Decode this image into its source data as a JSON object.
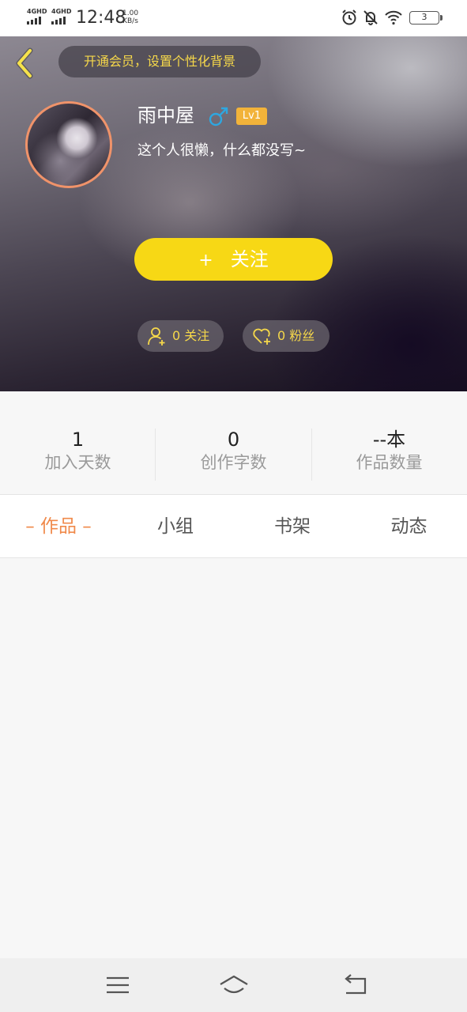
{
  "status_bar": {
    "network1": "4GHD",
    "network2": "4GHD",
    "time": "12:48",
    "speed_value": "1.00",
    "speed_unit": "KB/s",
    "battery": "3",
    "icons": [
      "alarm-icon",
      "mute-icon",
      "wifi-icon",
      "battery-icon"
    ]
  },
  "header": {
    "vip_banner": "开通会员，设置个性化背景",
    "username": "雨中屋",
    "gender_icon": "male-icon",
    "level": "Lv1",
    "bio": "这个人很懒，什么都没写~",
    "follow_plus": "+",
    "follow_label": "关注",
    "following_chip": "0 关注",
    "fans_chip": "0 粉丝",
    "accent_color": "#f7d815",
    "vip_text_color": "#f6d84a",
    "gender_color": "#2ea7e0",
    "level_color": "#f2b33a"
  },
  "stats": [
    {
      "value": "1",
      "label": "加入天数"
    },
    {
      "value": "0",
      "label": "创作字数"
    },
    {
      "value": "--本",
      "label": "作品数量"
    }
  ],
  "tabs": [
    {
      "label": "– 作品 –",
      "active": true
    },
    {
      "label": "小组",
      "active": false
    },
    {
      "label": "书架",
      "active": false
    },
    {
      "label": "动态",
      "active": false
    }
  ],
  "tab_active_color": "#f08a4b",
  "navbar": {
    "icons": [
      "menu-icon",
      "home-icon",
      "back-icon"
    ]
  }
}
